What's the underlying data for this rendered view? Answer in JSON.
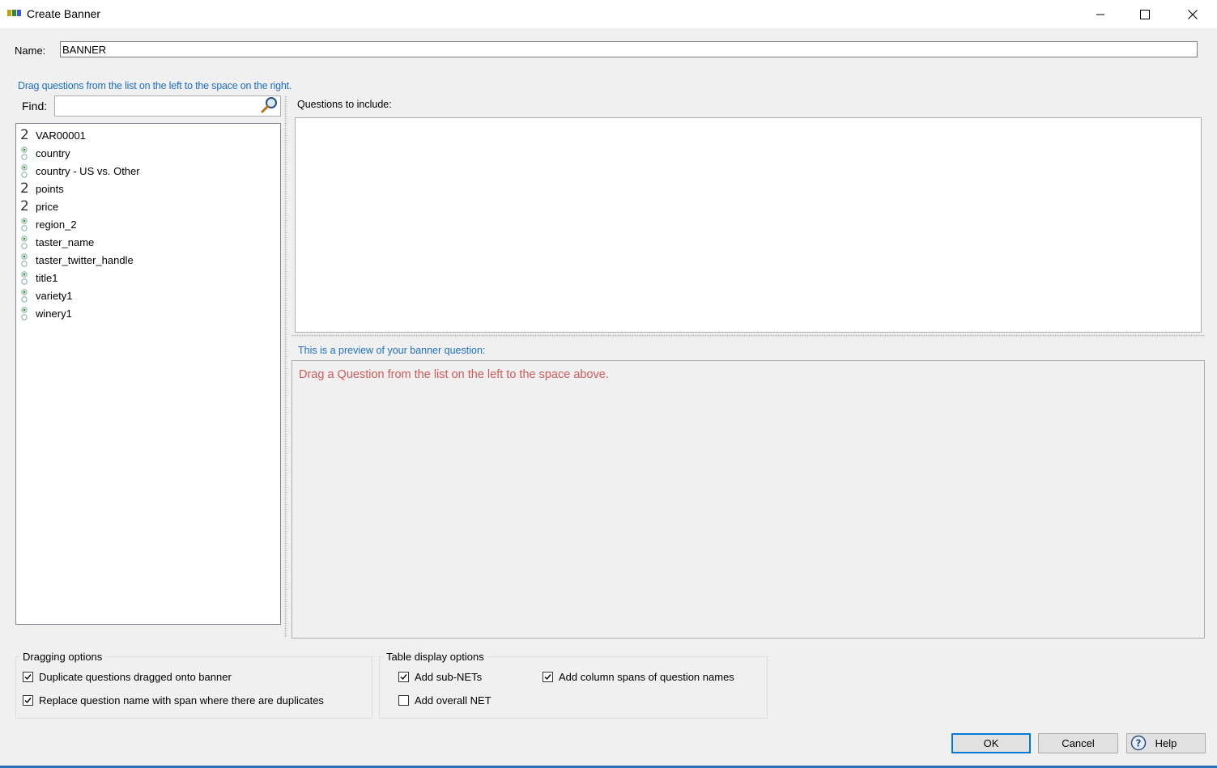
{
  "window": {
    "title": "Create Banner",
    "app_icon": "banner-app-icon",
    "controls": {
      "minimize": "minimize-icon",
      "maximize": "maximize-icon",
      "close": "close-icon"
    }
  },
  "name_field": {
    "label": "Name:",
    "value": "BANNER"
  },
  "instruction": "Drag questions from the list on the left to the space on the right.",
  "find": {
    "label": "Find:",
    "placeholder": "",
    "icon": "search-icon"
  },
  "questions": [
    {
      "label": "VAR00001",
      "type": "numeric"
    },
    {
      "label": "country",
      "type": "categorical"
    },
    {
      "label": "country - US vs. Other",
      "type": "categorical"
    },
    {
      "label": "points",
      "type": "numeric"
    },
    {
      "label": "price",
      "type": "numeric"
    },
    {
      "label": "region_2",
      "type": "categorical"
    },
    {
      "label": "taster_name",
      "type": "categorical"
    },
    {
      "label": "taster_twitter_handle",
      "type": "categorical"
    },
    {
      "label": "title1",
      "type": "categorical"
    },
    {
      "label": "variety1",
      "type": "categorical"
    },
    {
      "label": "winery1",
      "type": "categorical"
    }
  ],
  "include": {
    "label": "Questions to include:"
  },
  "preview": {
    "label": "This is a preview of your banner question:",
    "hint": "Drag a Question from the list on the left to the space above."
  },
  "dragging_options": {
    "title": "Dragging options",
    "items": [
      {
        "label": "Duplicate questions dragged onto banner",
        "checked": true
      },
      {
        "label": "Replace question name with span where there are duplicates",
        "checked": true
      }
    ]
  },
  "table_display_options": {
    "title": "Table display options",
    "items": [
      {
        "label": "Add sub-NETs",
        "checked": true
      },
      {
        "label": "Add column spans of question names",
        "checked": true
      },
      {
        "label": "Add overall NET",
        "checked": false
      }
    ]
  },
  "buttons": {
    "ok": "OK",
    "cancel": "Cancel",
    "help": "Help"
  },
  "colors": {
    "accent": "#0078d7",
    "link_blue": "#1e6fc0",
    "hint_red": "#d05a5a"
  }
}
